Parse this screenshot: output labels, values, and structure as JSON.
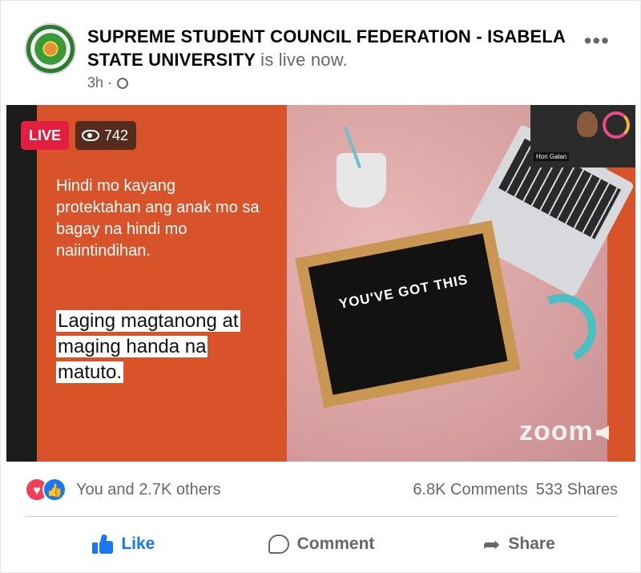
{
  "post": {
    "page_name": "SUPREME STUDENT COUNCIL FEDERATION - ISABELA STATE UNIVERSITY",
    "status_text": "is live now.",
    "time": "3h ·"
  },
  "video": {
    "live_label": "LIVE",
    "viewer_count": "742",
    "slide_text": "Hindi mo kayang protektahan ang anak mo sa bagay na hindi mo naiintindihan.",
    "highlight_text": "Laging magtanong at maging handa na matuto.",
    "board_text": "YOU'VE GOT THIS",
    "watermark": "zoom",
    "cam_name": "Hon Galan"
  },
  "engagement": {
    "reactions_text": "You and 2.7K others",
    "comments": "6.8K Comments",
    "shares": "533 Shares"
  },
  "actions": {
    "like": "Like",
    "comment": "Comment",
    "share": "Share"
  },
  "icons": [
    "globe-icon",
    "more-icon",
    "eye-icon",
    "heart-reaction-icon",
    "like-reaction-icon",
    "like-icon",
    "comment-icon",
    "share-icon"
  ],
  "colors": {
    "live_red": "#e41e3f",
    "like_blue": "#1877f2",
    "slide_orange": "#d9532a"
  }
}
